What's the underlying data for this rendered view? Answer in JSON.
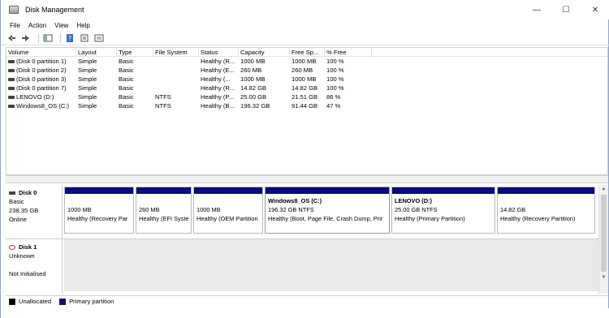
{
  "window": {
    "title": "Disk Management",
    "minimize": "—",
    "maximize": "☐",
    "close": "✕"
  },
  "menu": [
    "File",
    "Action",
    "View",
    "Help"
  ],
  "table": {
    "columns": [
      "Volume",
      "Layout",
      "Type",
      "File System",
      "Status",
      "Capacity",
      "Free Sp...",
      "% Free"
    ],
    "rows": [
      [
        "(Disk 0 partition 1)",
        "Simple",
        "Basic",
        "",
        "Healthy (R...",
        "1000 MB",
        "1000 MB",
        "100 %"
      ],
      [
        "(Disk 0 partition 2)",
        "Simple",
        "Basic",
        "",
        "Healthy (E...",
        "260 MB",
        "260 MB",
        "100 %"
      ],
      [
        "(Disk 0 partition 3)",
        "Simple",
        "Basic",
        "",
        "Healthy (...",
        "1000 MB",
        "1000 MB",
        "100 %"
      ],
      [
        "(Disk 0 partition 7)",
        "Simple",
        "Basic",
        "",
        "Healthy (R...",
        "14.82 GB",
        "14.82 GB",
        "100 %"
      ],
      [
        "LENOVO (D:)",
        "Simple",
        "Basic",
        "NTFS",
        "Healthy (P...",
        "25.00 GB",
        "21.51 GB",
        "86 %"
      ],
      [
        "Windows8_OS (C:)",
        "Simple",
        "Basic",
        "NTFS",
        "Healthy (B...",
        "196.32 GB",
        "91.44 GB",
        "47 %"
      ]
    ]
  },
  "disk0": {
    "name": "Disk 0",
    "type": "Basic",
    "size": "238.35 GB",
    "status": "Online",
    "partitions": [
      {
        "name": "",
        "size": "1000 MB",
        "status": "Healthy (Recovery Par"
      },
      {
        "name": "",
        "size": "260 MB",
        "status": "Healthy (EFI Syste"
      },
      {
        "name": "",
        "size": "1000 MB",
        "status": "Healthy (OEM Partition"
      },
      {
        "name": "Windows8_OS  (C:)",
        "size": "196.32 GB NTFS",
        "status": "Healthy (Boot, Page File, Crash Dump, Prir"
      },
      {
        "name": "LENOVO  (D:)",
        "size": "25.00 GB NTFS",
        "status": "Healthy (Primary Partition)"
      },
      {
        "name": "",
        "size": "14.82 GB",
        "status": "Healthy (Recovery Partition)"
      }
    ]
  },
  "disk1": {
    "name": "Disk 1",
    "type": "Unknown",
    "status": "Not Initialised"
  },
  "legend": [
    {
      "label": "Unallocated",
      "color": "#000000"
    },
    {
      "label": "Primary partition",
      "color": "#0b0b7e"
    }
  ],
  "colors": {
    "partition_bar": "#0b0b7e",
    "unallocated": "#000000"
  }
}
